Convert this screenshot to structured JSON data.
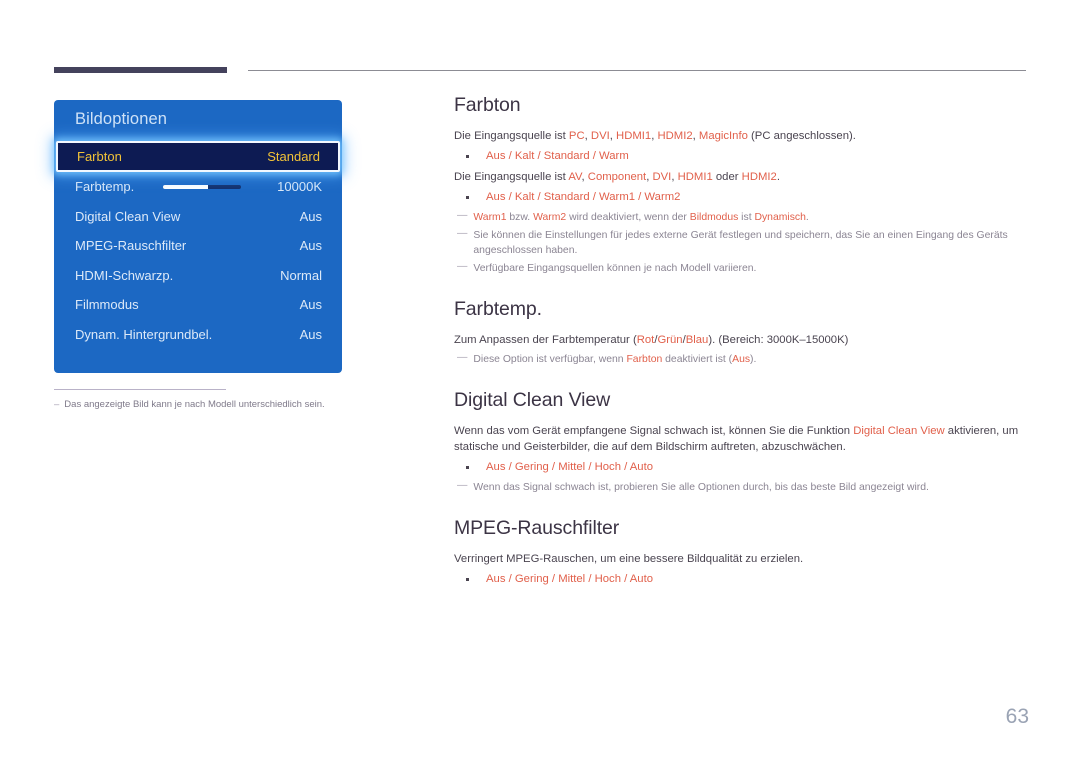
{
  "page": {
    "number": "63"
  },
  "osd": {
    "title": "Bildoptionen",
    "rows": [
      {
        "label": "Farbton",
        "value": "Standard",
        "selected": true,
        "slider": false
      },
      {
        "label": "Farbtemp.",
        "value": "10000K",
        "selected": false,
        "slider": true
      },
      {
        "label": "Digital Clean View",
        "value": "Aus",
        "selected": false,
        "slider": false
      },
      {
        "label": "MPEG-Rauschfilter",
        "value": "Aus",
        "selected": false,
        "slider": false
      },
      {
        "label": "HDMI-Schwarzp.",
        "value": "Normal",
        "selected": false,
        "slider": false
      },
      {
        "label": "Filmmodus",
        "value": "Aus",
        "selected": false,
        "slider": false
      },
      {
        "label": "Dynam. Hintergrundbel.",
        "value": "Aus",
        "selected": false,
        "slider": false
      }
    ],
    "note_dash": "–",
    "note_text": "Das angezeigte Bild kann je nach Modell unterschiedlich sein."
  },
  "content": {
    "note_dash": "—",
    "sections": [
      {
        "heading": "Farbton",
        "paragraph1_parts": [
          {
            "t": "Die Eingangsquelle ist ",
            "a": false
          },
          {
            "t": "PC",
            "a": true
          },
          {
            "t": ", ",
            "a": false
          },
          {
            "t": "DVI",
            "a": true
          },
          {
            "t": ", ",
            "a": false
          },
          {
            "t": "HDMI1",
            "a": true
          },
          {
            "t": ", ",
            "a": false
          },
          {
            "t": "HDMI2",
            "a": true
          },
          {
            "t": ", ",
            "a": false
          },
          {
            "t": "MagicInfo",
            "a": true
          },
          {
            "t": " (PC angeschlossen).",
            "a": false
          }
        ],
        "options1": "Aus / Kalt / Standard / Warm",
        "paragraph2_parts": [
          {
            "t": "Die Eingangsquelle ist ",
            "a": false
          },
          {
            "t": "AV",
            "a": true
          },
          {
            "t": ", ",
            "a": false
          },
          {
            "t": "Component",
            "a": true
          },
          {
            "t": ", ",
            "a": false
          },
          {
            "t": "DVI",
            "a": true
          },
          {
            "t": ", ",
            "a": false
          },
          {
            "t": "HDMI1",
            "a": true
          },
          {
            "t": " oder ",
            "a": false
          },
          {
            "t": "HDMI2",
            "a": true
          },
          {
            "t": ".",
            "a": false
          }
        ],
        "options2": "Aus / Kalt / Standard / Warm1 / Warm2",
        "notes": [
          [
            {
              "t": "Warm1",
              "a": true
            },
            {
              "t": " bzw. ",
              "a": false
            },
            {
              "t": "Warm2",
              "a": true
            },
            {
              "t": " wird deaktiviert, wenn der ",
              "a": false
            },
            {
              "t": "Bildmodus",
              "a": true
            },
            {
              "t": " ist ",
              "a": false
            },
            {
              "t": "Dynamisch",
              "a": true
            },
            {
              "t": ".",
              "a": false
            }
          ],
          [
            {
              "t": "Sie können die Einstellungen für jedes externe Gerät festlegen und speichern, das Sie an einen Eingang des Geräts angeschlossen haben.",
              "a": false
            }
          ],
          [
            {
              "t": "Verfügbare Eingangsquellen können je nach Modell variieren.",
              "a": false
            }
          ]
        ]
      },
      {
        "heading": "Farbtemp.",
        "paragraph1_parts": [
          {
            "t": "Zum Anpassen der Farbtemperatur (",
            "a": false
          },
          {
            "t": "Rot",
            "a": true
          },
          {
            "t": "/",
            "a": false
          },
          {
            "t": "Grün",
            "a": true
          },
          {
            "t": "/",
            "a": false
          },
          {
            "t": "Blau",
            "a": true
          },
          {
            "t": "). (Bereich: 3000K–15000K)",
            "a": false
          }
        ],
        "notes": [
          [
            {
              "t": "Diese Option ist verfügbar, wenn ",
              "a": false
            },
            {
              "t": "Farbton",
              "a": true
            },
            {
              "t": " deaktiviert ist (",
              "a": false
            },
            {
              "t": "Aus",
              "a": true
            },
            {
              "t": ").",
              "a": false
            }
          ]
        ]
      },
      {
        "heading": "Digital Clean View",
        "paragraph1_parts": [
          {
            "t": "Wenn das vom Gerät empfangene Signal schwach ist, können Sie die Funktion ",
            "a": false
          },
          {
            "t": "Digital Clean View",
            "a": true
          },
          {
            "t": " aktivieren, um statische und Geisterbilder, die auf dem Bildschirm auftreten, abzuschwächen.",
            "a": false
          }
        ],
        "options1": "Aus / Gering / Mittel / Hoch / Auto",
        "notes": [
          [
            {
              "t": "Wenn das Signal schwach ist, probieren Sie alle Optionen durch, bis das beste Bild angezeigt wird.",
              "a": false
            }
          ]
        ]
      },
      {
        "heading": "MPEG-Rauschfilter",
        "paragraph1_parts": [
          {
            "t": "Verringert MPEG-Rauschen, um eine bessere Bildqualität zu erzielen.",
            "a": false
          }
        ],
        "options1": "Aus / Gering / Mittel / Hoch / Auto",
        "notes": []
      }
    ]
  }
}
